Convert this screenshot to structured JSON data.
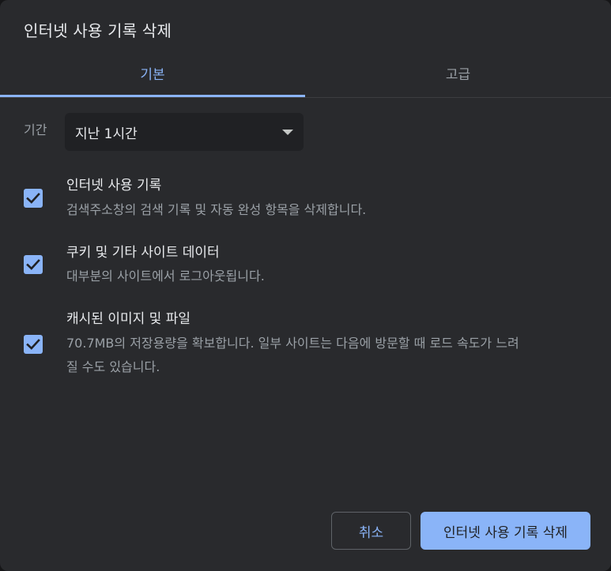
{
  "dialog": {
    "title": "인터넷 사용 기록 삭제"
  },
  "tabs": [
    {
      "label": "기본",
      "selected": true
    },
    {
      "label": "고급",
      "selected": false
    }
  ],
  "period": {
    "label": "기간",
    "selected_value": "지난 1시간"
  },
  "options": [
    {
      "title": "인터넷 사용 기록",
      "description": "검색주소창의 검색 기록 및 자동 완성 항목을 삭제합니다.",
      "checked": true
    },
    {
      "title": "쿠키 및 기타 사이트 데이터",
      "description": "대부분의 사이트에서 로그아웃됩니다.",
      "checked": true
    },
    {
      "title": "캐시된 이미지 및 파일",
      "description_line1": "70.7MB의 저장용량을 확보합니다. 일부 사이트는 다음에 방문할 때 로드 속도가 느려",
      "description_line2": "질 수도 있습니다.",
      "checked": true
    }
  ],
  "buttons": {
    "cancel_label": "취소",
    "delete_label": "인터넷 사용 기록 삭제"
  },
  "colors": {
    "background": "#292a2d",
    "accent": "#8ab4f8",
    "text_primary": "#e8eaed",
    "text_secondary": "#9aa0a6"
  },
  "icons": {
    "checkbox_mark": "check-icon",
    "select_arrow": "dropdown-arrow-icon"
  }
}
